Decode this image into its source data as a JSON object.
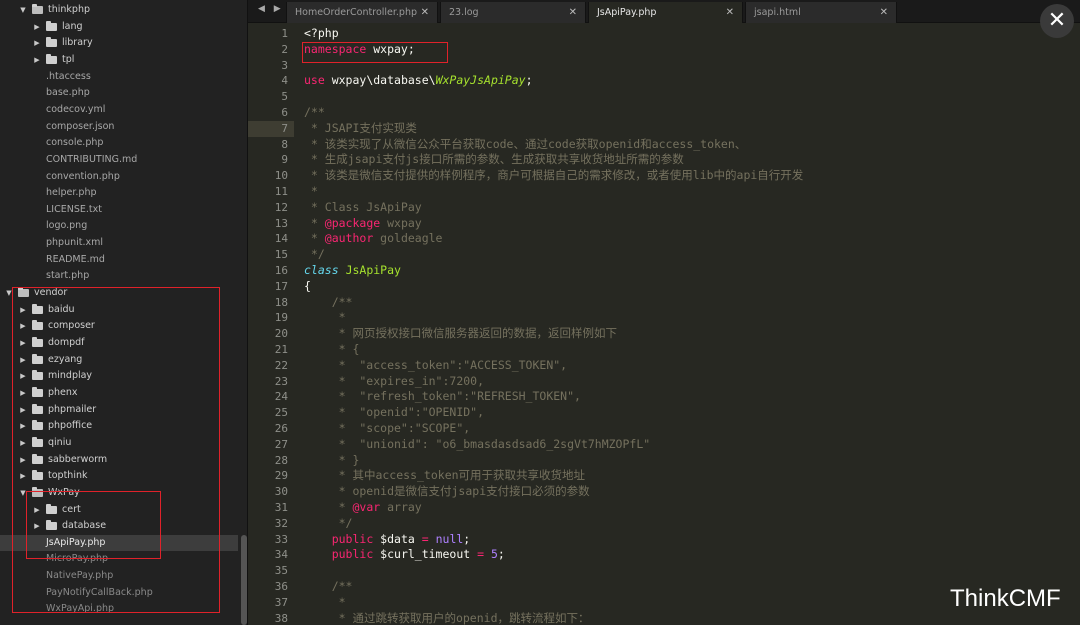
{
  "sidebar": {
    "items": [
      {
        "label": "thinkphp",
        "kind": "folder",
        "open": true,
        "depth": 1
      },
      {
        "label": "lang",
        "kind": "folder",
        "open": false,
        "depth": 2
      },
      {
        "label": "library",
        "kind": "folder",
        "open": false,
        "depth": 2
      },
      {
        "label": "tpl",
        "kind": "folder",
        "open": false,
        "depth": 2
      },
      {
        "label": ".htaccess",
        "kind": "file",
        "depth": 2
      },
      {
        "label": "base.php",
        "kind": "file",
        "depth": 2
      },
      {
        "label": "codecov.yml",
        "kind": "file",
        "depth": 2
      },
      {
        "label": "composer.json",
        "kind": "file",
        "depth": 2
      },
      {
        "label": "console.php",
        "kind": "file",
        "depth": 2
      },
      {
        "label": "CONTRIBUTING.md",
        "kind": "file",
        "depth": 2
      },
      {
        "label": "convention.php",
        "kind": "file",
        "depth": 2
      },
      {
        "label": "helper.php",
        "kind": "file",
        "depth": 2
      },
      {
        "label": "LICENSE.txt",
        "kind": "file",
        "depth": 2
      },
      {
        "label": "logo.png",
        "kind": "file",
        "depth": 2
      },
      {
        "label": "phpunit.xml",
        "kind": "file",
        "depth": 2
      },
      {
        "label": "README.md",
        "kind": "file",
        "depth": 2
      },
      {
        "label": "start.php",
        "kind": "file",
        "depth": 2
      },
      {
        "label": "vendor",
        "kind": "folder",
        "open": true,
        "depth": 0
      },
      {
        "label": "baidu",
        "kind": "folder",
        "open": false,
        "depth": 1
      },
      {
        "label": "composer",
        "kind": "folder",
        "open": false,
        "depth": 1
      },
      {
        "label": "dompdf",
        "kind": "folder",
        "open": false,
        "depth": 1
      },
      {
        "label": "ezyang",
        "kind": "folder",
        "open": false,
        "depth": 1
      },
      {
        "label": "mindplay",
        "kind": "folder",
        "open": false,
        "depth": 1
      },
      {
        "label": "phenx",
        "kind": "folder",
        "open": false,
        "depth": 1
      },
      {
        "label": "phpmailer",
        "kind": "folder",
        "open": false,
        "depth": 1
      },
      {
        "label": "phpoffice",
        "kind": "folder",
        "open": false,
        "depth": 1
      },
      {
        "label": "qiniu",
        "kind": "folder",
        "open": false,
        "depth": 1
      },
      {
        "label": "sabberworm",
        "kind": "folder",
        "open": false,
        "depth": 1
      },
      {
        "label": "topthink",
        "kind": "folder",
        "open": false,
        "depth": 1
      },
      {
        "label": "WxPay",
        "kind": "folder",
        "open": true,
        "depth": 1
      },
      {
        "label": "cert",
        "kind": "folder",
        "open": false,
        "depth": 2
      },
      {
        "label": "database",
        "kind": "folder",
        "open": false,
        "depth": 2
      },
      {
        "label": "JsApiPay.php",
        "kind": "file",
        "depth": 2,
        "selected": true
      },
      {
        "label": "MicroPay.php",
        "kind": "file",
        "depth": 2
      },
      {
        "label": "NativePay.php",
        "kind": "file",
        "depth": 2
      },
      {
        "label": "PayNotifyCallBack.php",
        "kind": "file",
        "depth": 2
      },
      {
        "label": "WxPayApi.php",
        "kind": "file",
        "depth": 2
      }
    ]
  },
  "tabs": [
    {
      "label": "HomeOrderController.php",
      "close": "✕",
      "active": false
    },
    {
      "label": "23.log",
      "close": "✕",
      "active": false
    },
    {
      "label": "JsApiPay.php",
      "close": "✕",
      "active": true
    },
    {
      "label": "jsapi.html",
      "close": "✕",
      "active": false
    }
  ],
  "nav_arrows": "◀ ▶",
  "editor": {
    "current_line": 7,
    "lines": [
      {
        "n": "1",
        "t": [
          [
            "def",
            "<?php"
          ]
        ]
      },
      {
        "n": "2",
        "t": [
          [
            "kw",
            "namespace"
          ],
          [
            "def",
            " wxpay;"
          ]
        ]
      },
      {
        "n": "3",
        "t": []
      },
      {
        "n": "4",
        "t": [
          [
            "kw",
            "use"
          ],
          [
            "def",
            " wxpay\\database\\"
          ],
          [
            "cls",
            "WxPayJsApiPay"
          ],
          [
            "def",
            ";"
          ]
        ]
      },
      {
        "n": "5",
        "t": []
      },
      {
        "n": "6",
        "t": [
          [
            "cmt",
            "/**"
          ]
        ]
      },
      {
        "n": "7",
        "t": [
          [
            "cmt",
            " * JSAPI支付实现类"
          ]
        ]
      },
      {
        "n": "8",
        "t": [
          [
            "cmt",
            " * 该类实现了从微信公众平台获取code、通过code获取openid和access_token、"
          ]
        ]
      },
      {
        "n": "9",
        "t": [
          [
            "cmt",
            " * 生成jsapi支付js接口所需的参数、生成获取共享收货地址所需的参数"
          ]
        ]
      },
      {
        "n": "10",
        "t": [
          [
            "cmt",
            " * 该类是微信支付提供的样例程序，商户可根据自己的需求修改，或者使用lib中的api自行开发"
          ]
        ]
      },
      {
        "n": "11",
        "t": [
          [
            "cmt",
            " *"
          ]
        ]
      },
      {
        "n": "12",
        "t": [
          [
            "cmt",
            " * Class JsApiPay"
          ]
        ]
      },
      {
        "n": "13",
        "t": [
          [
            "cmt",
            " * "
          ],
          [
            "kw",
            "@package"
          ],
          [
            "cmt",
            " wxpay"
          ]
        ]
      },
      {
        "n": "14",
        "t": [
          [
            "cmt",
            " * "
          ],
          [
            "kw",
            "@author"
          ],
          [
            "cmt",
            " goldeagle"
          ]
        ]
      },
      {
        "n": "15",
        "t": [
          [
            "cmt",
            " */"
          ]
        ]
      },
      {
        "n": "16",
        "t": [
          [
            "kwi",
            "class"
          ],
          [
            "def",
            " "
          ],
          [
            "fn",
            "JsApiPay"
          ]
        ]
      },
      {
        "n": "17",
        "t": [
          [
            "def",
            "{"
          ]
        ]
      },
      {
        "n": "18",
        "t": [
          [
            "cmt",
            "    /**"
          ]
        ]
      },
      {
        "n": "19",
        "t": [
          [
            "cmt",
            "     *"
          ]
        ]
      },
      {
        "n": "20",
        "t": [
          [
            "cmt",
            "     * 网页授权接口微信服务器返回的数据，返回样例如下"
          ]
        ]
      },
      {
        "n": "21",
        "t": [
          [
            "cmt",
            "     * {"
          ]
        ]
      },
      {
        "n": "22",
        "t": [
          [
            "cmt",
            "     *  \"access_token\":\"ACCESS_TOKEN\","
          ]
        ]
      },
      {
        "n": "23",
        "t": [
          [
            "cmt",
            "     *  \"expires_in\":7200,"
          ]
        ]
      },
      {
        "n": "24",
        "t": [
          [
            "cmt",
            "     *  \"refresh_token\":\"REFRESH_TOKEN\","
          ]
        ]
      },
      {
        "n": "25",
        "t": [
          [
            "cmt",
            "     *  \"openid\":\"OPENID\","
          ]
        ]
      },
      {
        "n": "26",
        "t": [
          [
            "cmt",
            "     *  \"scope\":\"SCOPE\","
          ]
        ]
      },
      {
        "n": "27",
        "t": [
          [
            "cmt",
            "     *  \"unionid\": \"o6_bmasdasdsad6_2sgVt7hMZOPfL\""
          ]
        ]
      },
      {
        "n": "28",
        "t": [
          [
            "cmt",
            "     * }"
          ]
        ]
      },
      {
        "n": "29",
        "t": [
          [
            "cmt",
            "     * 其中access_token可用于获取共享收货地址"
          ]
        ]
      },
      {
        "n": "30",
        "t": [
          [
            "cmt",
            "     * openid是微信支付jsapi支付接口必须的参数"
          ]
        ]
      },
      {
        "n": "31",
        "t": [
          [
            "cmt",
            "     * "
          ],
          [
            "kw",
            "@var"
          ],
          [
            "cmt",
            " array"
          ]
        ]
      },
      {
        "n": "32",
        "t": [
          [
            "cmt",
            "     */"
          ]
        ]
      },
      {
        "n": "33",
        "t": [
          [
            "def",
            "    "
          ],
          [
            "kw",
            "public"
          ],
          [
            "def",
            " $data "
          ],
          [
            "kw",
            "="
          ],
          [
            "def",
            " "
          ],
          [
            "num",
            "null"
          ],
          [
            "def",
            ";"
          ]
        ]
      },
      {
        "n": "34",
        "t": [
          [
            "def",
            "    "
          ],
          [
            "kw",
            "public"
          ],
          [
            "def",
            " $curl_timeout "
          ],
          [
            "kw",
            "="
          ],
          [
            "def",
            " "
          ],
          [
            "num",
            "5"
          ],
          [
            "def",
            ";"
          ]
        ]
      },
      {
        "n": "35",
        "t": []
      },
      {
        "n": "36",
        "t": [
          [
            "cmt",
            "    /**"
          ]
        ]
      },
      {
        "n": "37",
        "t": [
          [
            "cmt",
            "     *"
          ]
        ]
      },
      {
        "n": "38",
        "t": [
          [
            "cmt",
            "     * 通过跳转获取用户的openid，跳转流程如下："
          ]
        ]
      }
    ]
  },
  "close_button": "✕",
  "watermark": "ThinkCMF",
  "colors": {
    "editor_bg": "#272822",
    "sidebar_bg": "#222222",
    "annotation_red": "#e0222a",
    "keyword": "#f92672",
    "comment": "#75715e",
    "class_name": "#a6e22e",
    "number": "#ae81ff"
  }
}
